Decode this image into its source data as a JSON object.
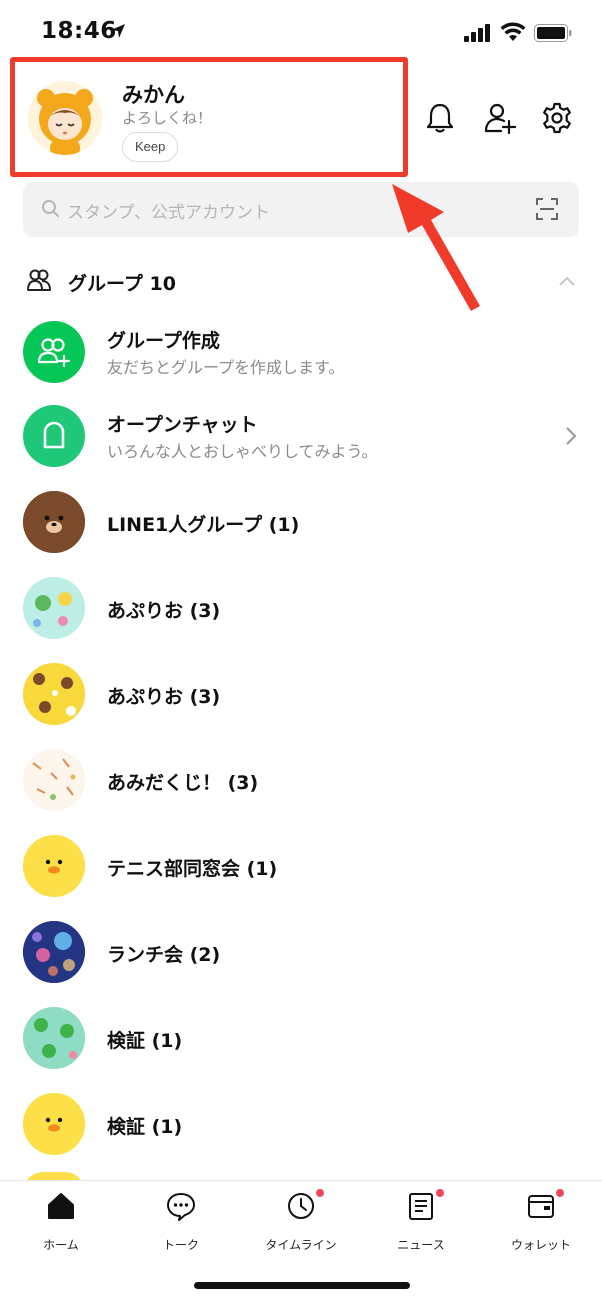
{
  "status_bar": {
    "time": "18:46"
  },
  "profile": {
    "name": "みかん",
    "status": "よろしくね！",
    "keep_label": "Keep"
  },
  "search": {
    "placeholder": "スタンプ、公式アカウント"
  },
  "group_section": {
    "title": "グループ 10"
  },
  "rows": [
    {
      "title": "グループ作成",
      "subtitle": "友だちとグループを作成します。"
    },
    {
      "title": "オープンチャット",
      "subtitle": "いろんな人とおしゃべりしてみよう。"
    },
    {
      "title": "LINE1人グループ (1)"
    },
    {
      "title": "あぷりお (3)"
    },
    {
      "title": "あぷりお (3)"
    },
    {
      "title": "あみだくじ！ (3)"
    },
    {
      "title": "テニス部同窓会 (1)"
    },
    {
      "title": "ランチ会 (2)"
    },
    {
      "title": "検証 (1)"
    },
    {
      "title": "検証 (1)"
    }
  ],
  "tabs": [
    {
      "label": "ホーム",
      "icon": "home-icon"
    },
    {
      "label": "トーク",
      "icon": "chat-icon"
    },
    {
      "label": "タイムライン",
      "icon": "clock-icon"
    },
    {
      "label": "ニュース",
      "icon": "news-icon"
    },
    {
      "label": "ウォレット",
      "icon": "wallet-icon"
    }
  ],
  "colors": {
    "accent_green": "#06c755",
    "highlight_red": "#f03a2a",
    "badge_red": "#f0485a"
  }
}
